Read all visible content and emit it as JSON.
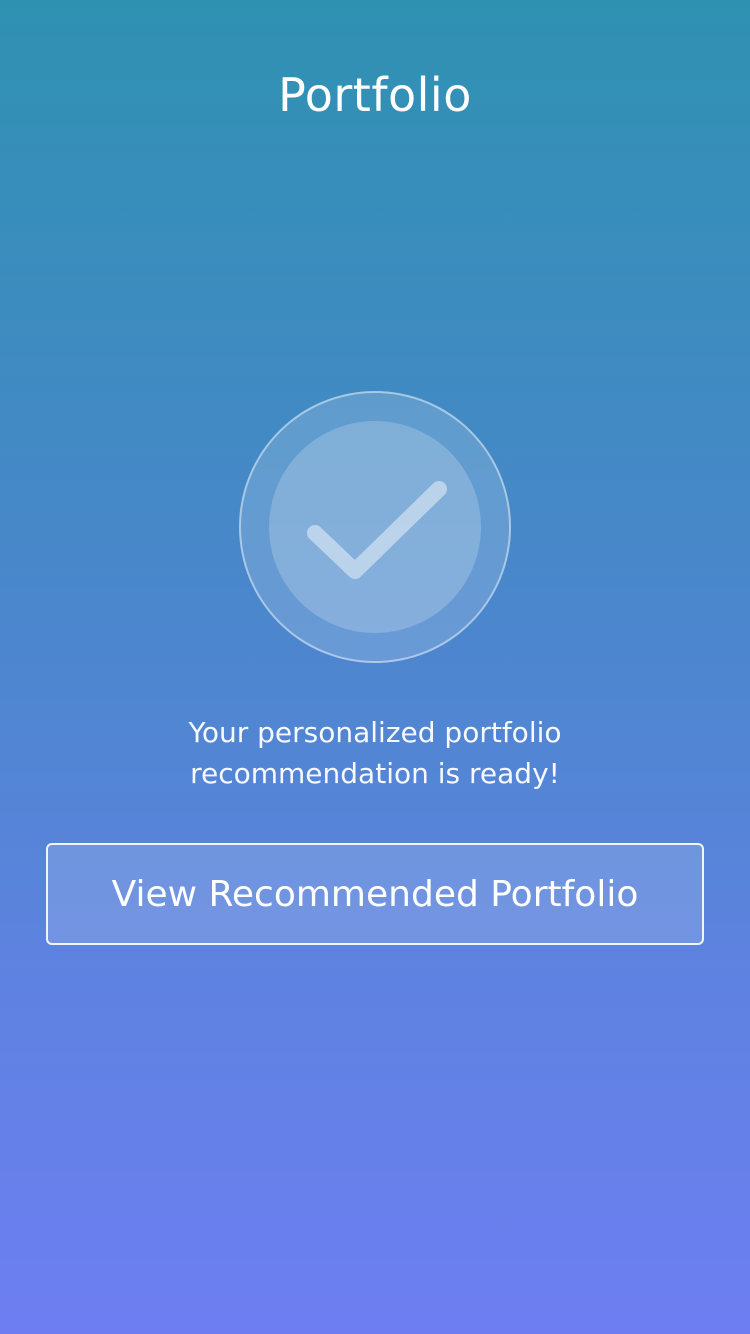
{
  "header": {
    "title": "Portfolio"
  },
  "status": {
    "icon": "checkmark-icon",
    "message_line_1": "Your personalized portfolio",
    "message_line_2": "recommendation is ready!"
  },
  "actions": {
    "view_recommended_label": "View Recommended Portfolio"
  },
  "colors": {
    "gradient_top": "#2f91b2",
    "gradient_bottom": "#6e7ef2",
    "text": "#ffffff"
  }
}
